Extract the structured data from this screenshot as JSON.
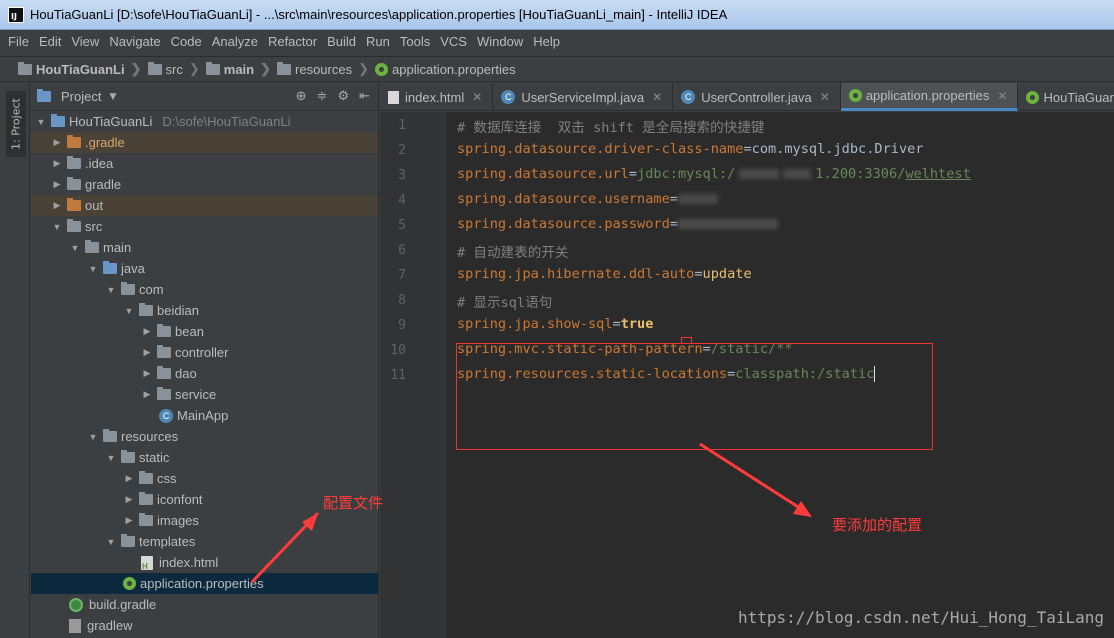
{
  "window": {
    "title": "HouTiaGuanLi [D:\\sofe\\HouTiaGuanLi] - ...\\src\\main\\resources\\application.properties [HouTiaGuanLi_main] - IntelliJ IDEA"
  },
  "menu": [
    "File",
    "Edit",
    "View",
    "Navigate",
    "Code",
    "Analyze",
    "Refactor",
    "Build",
    "Run",
    "Tools",
    "VCS",
    "Window",
    "Help"
  ],
  "breadcrumb": [
    "HouTiaGuanLi",
    "src",
    "main",
    "resources",
    "application.properties"
  ],
  "side_stripe": {
    "project_tab": "1: Project"
  },
  "project_panel": {
    "title": "Project",
    "tree": [
      {
        "label": "HouTiaGuanLi",
        "path": "D:\\sofe\\HouTiaGuanLi"
      },
      {
        "label": ".gradle"
      },
      {
        "label": ".idea"
      },
      {
        "label": "gradle"
      },
      {
        "label": "out"
      },
      {
        "label": "src"
      },
      {
        "label": "main"
      },
      {
        "label": "java"
      },
      {
        "label": "com"
      },
      {
        "label": "beidian"
      },
      {
        "label": "bean"
      },
      {
        "label": "controller"
      },
      {
        "label": "dao"
      },
      {
        "label": "service"
      },
      {
        "label": "MainApp"
      },
      {
        "label": "resources"
      },
      {
        "label": "static"
      },
      {
        "label": "css"
      },
      {
        "label": "iconfont"
      },
      {
        "label": "images"
      },
      {
        "label": "templates"
      },
      {
        "label": "index.html"
      },
      {
        "label": "application.properties"
      },
      {
        "label": "build.gradle"
      },
      {
        "label": "gradlew"
      }
    ]
  },
  "editor_tabs": [
    {
      "label": "index.html"
    },
    {
      "label": "UserServiceImpl.java"
    },
    {
      "label": "UserController.java"
    },
    {
      "label": "application.properties",
      "active": true
    },
    {
      "label": "HouTiaGuanLi"
    }
  ],
  "line_numbers": [
    "1",
    "2",
    "3",
    "4",
    "5",
    "6",
    "7",
    "8",
    "9",
    "10",
    "11"
  ],
  "code": {
    "l1": "# 数据库连接  双击 shift 是全局搜索的快捷键",
    "l2_key": "spring.datasource.driver-class-name",
    "l2_val": "com.mysql.jdbc.Driver",
    "l3_key": "spring.datasource.url",
    "l3_val_a": "jdbc:mysql:/",
    "l3_val_b": "1.200:3306/",
    "l3_val_c": "welhtest",
    "l4_key": "spring.datasource.username",
    "l5_key": "spring.datasource.password",
    "l6": "# 自动建表的开关",
    "l7_key": "spring.jpa.hibernate.ddl-auto",
    "l7_val": "update",
    "l8": "# 显示sql语句",
    "l9_key": "spring.jpa.show-sql",
    "l9_val": "true",
    "l10_key": "spring.mvc.static-path-pattern",
    "l10_val": "/static/**",
    "l11_key": "spring.resources.static-locations",
    "l11_val": "classpath:/static",
    "eq": "="
  },
  "annotations": {
    "config_file": "配置文件",
    "to_add": "要添加的配置"
  },
  "watermark": "https://blog.csdn.net/Hui_Hong_TaiLang",
  "colors": {
    "accent": "#4a88c7",
    "annotation_red": "#ff3b3b",
    "property_key": "#cc7832",
    "property_value": "#6a8759"
  }
}
